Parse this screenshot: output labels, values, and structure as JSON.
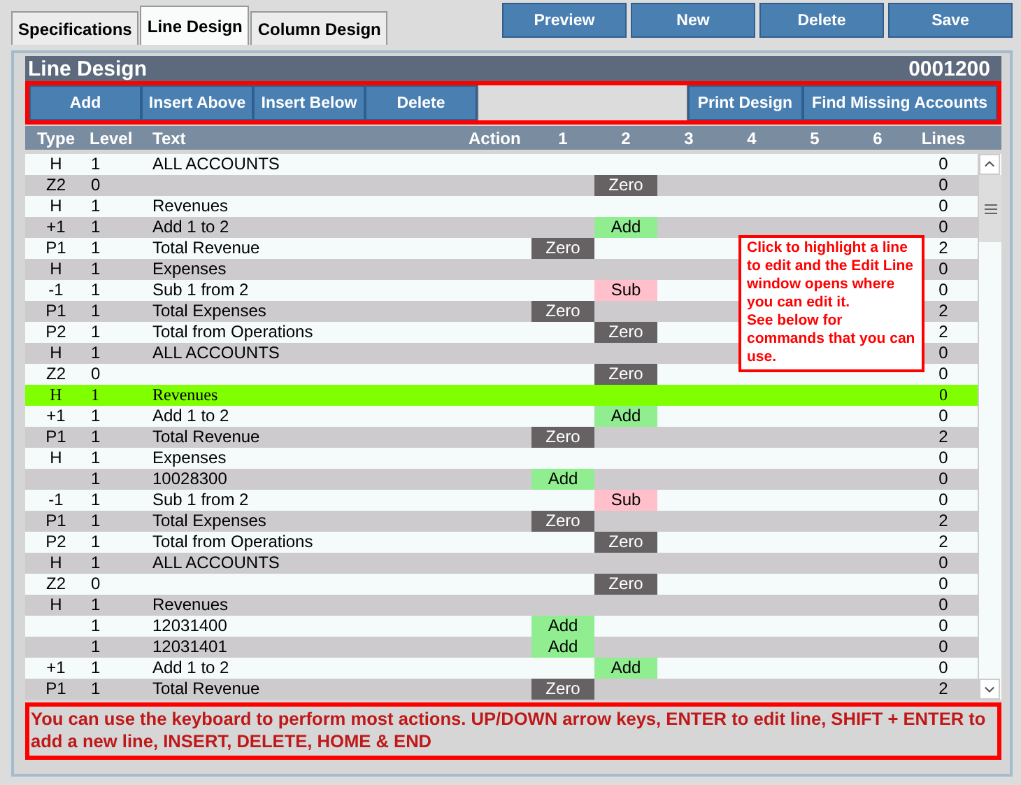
{
  "tabs": [
    {
      "label": "Specifications",
      "selected": false
    },
    {
      "label": "Line Design",
      "selected": true
    },
    {
      "label": "Column Design",
      "selected": false
    }
  ],
  "actions": [
    "Preview",
    "New",
    "Delete",
    "Save"
  ],
  "panel": {
    "title": "Line Design",
    "code": "0001200"
  },
  "toolbar": {
    "left": [
      "Add",
      "Insert Above",
      "Insert Below",
      "Delete"
    ],
    "right": [
      "Print Design",
      "Find Missing Accounts"
    ]
  },
  "table": {
    "columns": [
      "Type",
      "Level",
      "Text",
      "Action",
      "1",
      "2",
      "3",
      "4",
      "5",
      "6",
      "Lines"
    ],
    "rows": [
      {
        "type": "H",
        "level": "1",
        "text": "ALL ACCOUNTS",
        "lines": "0",
        "selected": false
      },
      {
        "type": "Z2",
        "level": "0",
        "cell_2": {
          "text": "Zero",
          "kind": "zero"
        },
        "lines": "0",
        "selected": false
      },
      {
        "type": "H",
        "level": "1",
        "text": "Revenues",
        "lines": "0",
        "selected": false
      },
      {
        "type": "+1",
        "level": "1",
        "text": "Add 1 to 2",
        "cell_2": {
          "text": "Add",
          "kind": "add"
        },
        "lines": "0",
        "selected": false
      },
      {
        "type": "P1",
        "level": "1",
        "text": "Total Revenue",
        "cell_1": {
          "text": "Zero",
          "kind": "zero"
        },
        "lines": "2",
        "selected": false
      },
      {
        "type": "H",
        "level": "1",
        "text": "Expenses",
        "lines": "0",
        "selected": false
      },
      {
        "type": "-1",
        "level": "1",
        "text": "Sub 1 from 2",
        "cell_2": {
          "text": "Sub",
          "kind": "sub"
        },
        "lines": "0",
        "selected": false
      },
      {
        "type": "P1",
        "level": "1",
        "text": "Total Expenses",
        "cell_1": {
          "text": "Zero",
          "kind": "zero"
        },
        "lines": "2",
        "selected": false
      },
      {
        "type": "P2",
        "level": "1",
        "text": "Total from Operations",
        "cell_2": {
          "text": "Zero",
          "kind": "zero"
        },
        "lines": "2",
        "selected": false
      },
      {
        "type": "H",
        "level": "1",
        "text": "ALL ACCOUNTS",
        "lines": "0",
        "selected": false
      },
      {
        "type": "Z2",
        "level": "0",
        "cell_2": {
          "text": "Zero",
          "kind": "zero"
        },
        "lines": "0",
        "selected": false
      },
      {
        "type": "H",
        "level": "1",
        "text": "Revenues",
        "lines": "0",
        "selected": true
      },
      {
        "type": "+1",
        "level": "1",
        "text": "Add 1 to 2",
        "cell_2": {
          "text": "Add",
          "kind": "add"
        },
        "lines": "0",
        "selected": false
      },
      {
        "type": "P1",
        "level": "1",
        "text": "Total Revenue",
        "cell_1": {
          "text": "Zero",
          "kind": "zero"
        },
        "lines": "2",
        "selected": false
      },
      {
        "type": "H",
        "level": "1",
        "text": "Expenses",
        "lines": "0",
        "selected": false
      },
      {
        "level": "1",
        "text": "10028300",
        "cell_1": {
          "text": "Add",
          "kind": "add"
        },
        "lines": "0",
        "selected": false
      },
      {
        "type": "-1",
        "level": "1",
        "text": "Sub 1 from 2",
        "cell_2": {
          "text": "Sub",
          "kind": "sub"
        },
        "lines": "0",
        "selected": false
      },
      {
        "type": "P1",
        "level": "1",
        "text": "Total Expenses",
        "cell_1": {
          "text": "Zero",
          "kind": "zero"
        },
        "lines": "2",
        "selected": false
      },
      {
        "type": "P2",
        "level": "1",
        "text": "Total from Operations",
        "cell_2": {
          "text": "Zero",
          "kind": "zero"
        },
        "lines": "2",
        "selected": false
      },
      {
        "type": "H",
        "level": "1",
        "text": "ALL ACCOUNTS",
        "lines": "0",
        "selected": false
      },
      {
        "type": "Z2",
        "level": "0",
        "cell_2": {
          "text": "Zero",
          "kind": "zero"
        },
        "lines": "0",
        "selected": false
      },
      {
        "type": "H",
        "level": "1",
        "text": "Revenues",
        "lines": "0",
        "selected": false
      },
      {
        "level": "1",
        "text": "12031400",
        "cell_1": {
          "text": "Add",
          "kind": "add"
        },
        "lines": "0",
        "selected": false
      },
      {
        "level": "1",
        "text": "12031401",
        "cell_1": {
          "text": "Add",
          "kind": "add"
        },
        "lines": "0",
        "selected": false
      },
      {
        "type": "+1",
        "level": "1",
        "text": "Add 1 to 2",
        "cell_2": {
          "text": "Add",
          "kind": "add"
        },
        "lines": "0",
        "selected": false
      },
      {
        "type": "P1",
        "level": "1",
        "text": "Total Revenue",
        "cell_1": {
          "text": "Zero",
          "kind": "zero"
        },
        "lines": "2",
        "selected": false
      }
    ]
  },
  "callout": "Click to highlight a line to edit and the Edit Line window opens where you can edit it.\nSee below for commands that you can use.",
  "keyboard_note": "You can use the keyboard to perform most actions.  UP/DOWN arrow keys, ENTER to edit line, SHIFT + ENTER to add a new line, INSERT, DELETE, HOME & END"
}
